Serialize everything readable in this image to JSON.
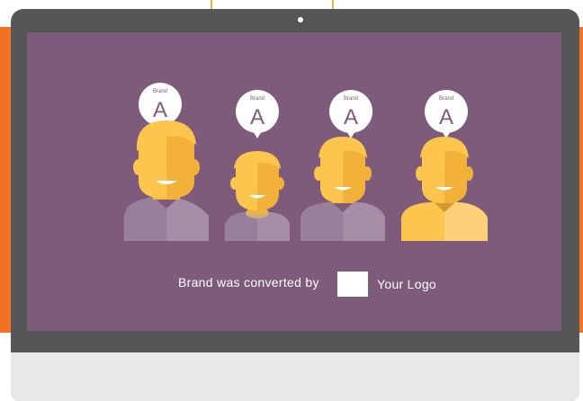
{
  "bubbles": [
    {
      "small_label": "Brand",
      "letter": "A"
    },
    {
      "small_label": "Brand",
      "letter": "A"
    },
    {
      "small_label": "Brand",
      "letter": "A"
    },
    {
      "small_label": "Brand",
      "letter": "A"
    }
  ],
  "caption": "Brand was converted by",
  "logo_label": "Your Logo",
  "colors": {
    "screen": "#7e5b7a",
    "skin": "#fcc64e",
    "skin_shadow": "#f2b23a",
    "body_gray": "#98809a",
    "body_gray_light": "#a58ea6",
    "body_yellow": "#fcc64e",
    "orange": "#f07324",
    "laptop_frame": "#555658"
  }
}
